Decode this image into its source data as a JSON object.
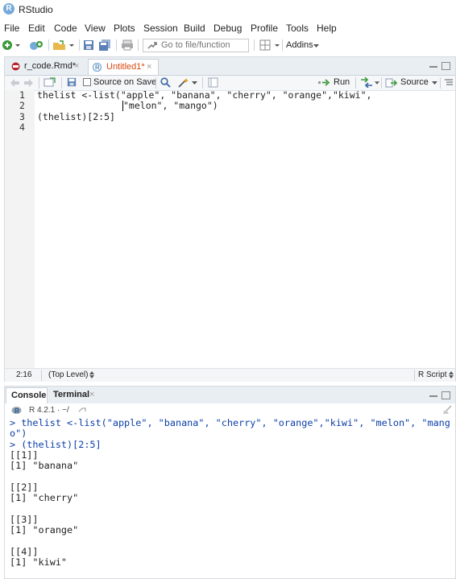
{
  "window": {
    "title": "RStudio",
    "logo": "R"
  },
  "menu": [
    "File",
    "Edit",
    "Code",
    "View",
    "Plots",
    "Session",
    "Build",
    "Debug",
    "Profile",
    "Tools",
    "Help"
  ],
  "toolbar": {
    "goto_placeholder": "Go to file/function",
    "addins": "Addins"
  },
  "editor": {
    "tabs": [
      {
        "label": "r_code.Rmd*",
        "active": false
      },
      {
        "label": "Untitled1*",
        "active": true
      }
    ],
    "source_on_save": "Source on Save",
    "run": "Run",
    "source": "Source",
    "lines": [
      "1",
      "2",
      "3",
      "4"
    ],
    "code": {
      "l1": "thelist <-list(\"apple\", \"banana\", \"cherry\", \"orange\",\"kiwi\",",
      "l2": "\"melon\", \"mango\")",
      "l3": "(thelist)[2:5]"
    },
    "status": {
      "position": "2:16",
      "scope": "(Top Level)",
      "type": "R Script"
    }
  },
  "console": {
    "tabs": [
      {
        "label": "Console",
        "active": true
      },
      {
        "label": "Terminal",
        "active": false
      }
    ],
    "version": "R 4.2.1 · ~/",
    "lines": [
      "> thelist <-list(\"apple\", \"banana\", \"cherry\", \"orange\",\"kiwi\", \"melon\", \"mang",
      "o\")",
      "> (thelist)[2:5]",
      "[[1]]",
      "[1] \"banana\"",
      "",
      "[[2]]",
      "[1] \"cherry\"",
      "",
      "[[3]]",
      "[1] \"orange\"",
      "",
      "[[4]]",
      "[1] \"kiwi\""
    ]
  },
  "colors": {
    "accent": "#75aadb",
    "tab_active_text": "#d9480f",
    "string": "#1a6b1a",
    "console_input": "#0b3ea8"
  }
}
